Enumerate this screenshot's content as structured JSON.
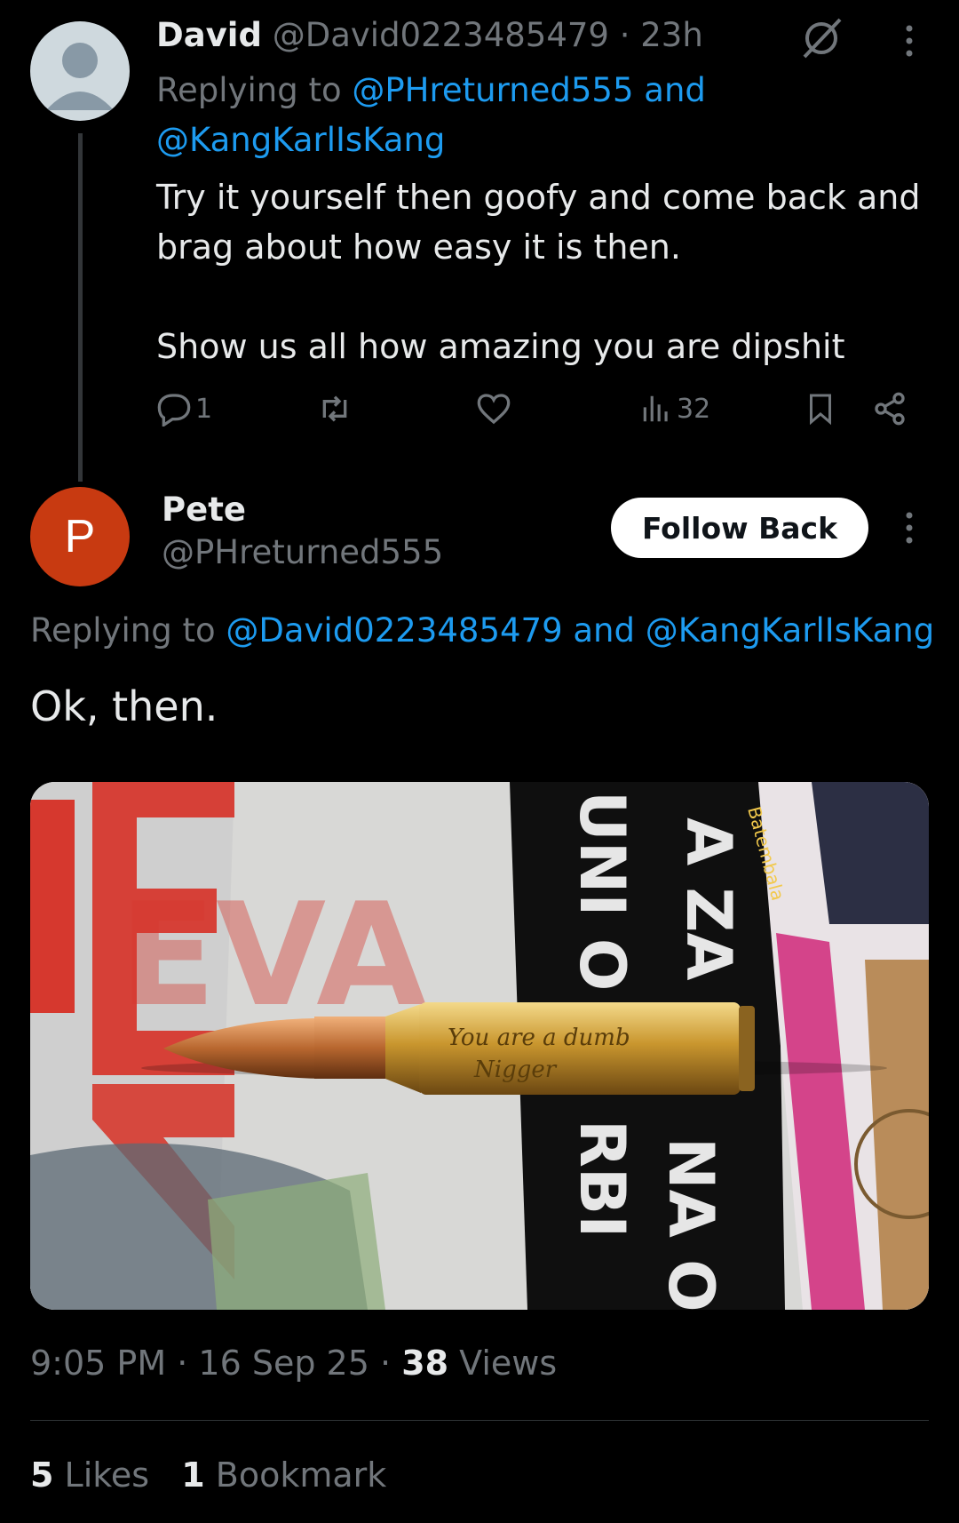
{
  "tweet1": {
    "name": "David",
    "handle": "@David0223485479",
    "time": "23h",
    "replying_prefix": "Replying to",
    "mention1": "@PHreturned555",
    "and": "and",
    "mention2": "@KangKarlIsKang",
    "text_line1": "Try it yourself then goofy and come back and brag about how easy it is then.",
    "text_line2": "Show us all how amazing you are dipshit",
    "replies": "1",
    "views": "32"
  },
  "tweet2": {
    "avatar_letter": "P",
    "name": "Pete",
    "handle": "@PHreturned555",
    "follow_label": "Follow Back",
    "replying_prefix": "Replying to",
    "mention1": "@David0223485479",
    "and": "and",
    "mention2": "@KangKarlIsKang",
    "text": "Ok, then.",
    "image_text": {
      "headline_top": "A ZA",
      "headline_2": "UNI O",
      "headline_3": "RBI",
      "headline_4": "NA O",
      "red_letters": "EVA",
      "brand": "Batembala",
      "engraving_1": "You are a dumb",
      "engraving_2": "Nigger"
    },
    "time": "9:05 PM",
    "date": "16 Sep 25",
    "views_count": "38",
    "views_label": "Views",
    "likes_count": "5",
    "likes_label": "Likes",
    "bookmarks_count": "1",
    "bookmarks_label": "Bookmark"
  },
  "colors": {
    "background": "#000000",
    "text": "#e7e9ea",
    "secondary": "#71767b",
    "link": "#1d9bf0",
    "pete_avatar": "#c83a11"
  }
}
